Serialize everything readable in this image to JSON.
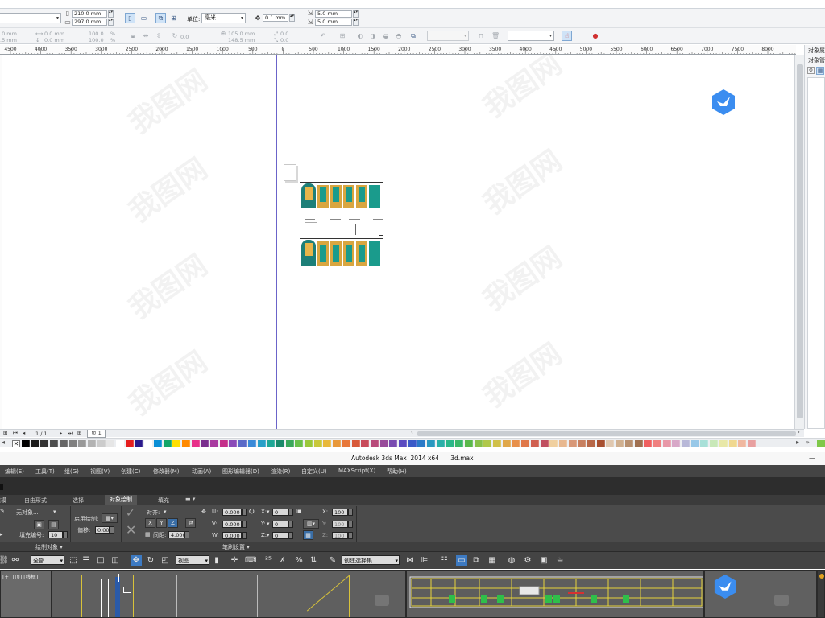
{
  "corel": {
    "propbar": {
      "page_width": "210.0 mm",
      "page_height": "297.0 mm",
      "units_label": "单位:",
      "units_value": "毫米",
      "nudge": "0.1 mm",
      "dup_x": "5.0 mm",
      "dup_y": "5.0 mm"
    },
    "propbar2": {
      "pos_x_a": "0.0 mm",
      "pos_y_a": "0.0 mm",
      "size_w": "0.0 mm",
      "size_h": "0.0 mm",
      "scale_w": "100.0",
      "scale_h": "100.0",
      "pct": "%",
      "rotate": "0.0",
      "rot_x": "105.0 mm",
      "rot_y": "148.5 mm",
      "skew_x": "0.0",
      "skew_y": "0.0",
      "left_x": ".0 mm",
      "left_y": ".5 mm"
    },
    "ruler_ticks": [
      "4500",
      "4000",
      "3500",
      "3000",
      "2500",
      "2000",
      "1500",
      "1000",
      "500",
      "0",
      "500",
      "1000",
      "1500",
      "2000",
      "2500",
      "3000",
      "3500",
      "4000",
      "4500",
      "5000",
      "5500",
      "6000",
      "6500",
      "7000",
      "7500",
      "8000"
    ],
    "docker": {
      "label1": "对象属",
      "label2": "对象管"
    },
    "page_nav": {
      "counter": "1 / 1",
      "page_tab": "页 1"
    },
    "palette_colors": [
      "#000000",
      "#1a1a1a",
      "#333333",
      "#4d4d4d",
      "#666666",
      "#808080",
      "#999999",
      "#b3b3b3",
      "#cccccc",
      "#e6e6e6",
      "#ffffff",
      "#e61e1e",
      "#2a1a8c",
      "#ffffff",
      "#0a8fd6",
      "#12a66a",
      "#ffe000",
      "#ff8a00",
      "#e8308a",
      "#7a2e8e",
      "#a93aa0",
      "#c52f8a",
      "#8a4ab8",
      "#5a6ac8",
      "#3a8ad8",
      "#28a0c8",
      "#1ea896",
      "#1a8a6a",
      "#3aa85a",
      "#6ac04a",
      "#9ac83a",
      "#c8c83a",
      "#e8b83a",
      "#e8983a",
      "#e8783a",
      "#d85a3a",
      "#c84a5a",
      "#b84a7a",
      "#984a9a",
      "#784ab0",
      "#5a4ac0",
      "#3a5ac8",
      "#2a7ac8",
      "#2a98c0",
      "#2ab0a8",
      "#2ab888",
      "#3ab868",
      "#5ab84a",
      "#88c04a",
      "#b0c84a",
      "#d0c04a",
      "#e0a84a",
      "#e8904a",
      "#e0784a",
      "#d06050",
      "#c05060",
      "#f0d0a0",
      "#e8b890",
      "#d89878",
      "#c88060",
      "#b86848",
      "#a85030",
      "#e0c8b0",
      "#d0b090",
      "#b89070",
      "#a07050",
      "#f06060",
      "#f08080",
      "#e898a8",
      "#d8a8c8",
      "#b8b8d8",
      "#98c8e8",
      "#a8e0d8",
      "#c8e8b8",
      "#e8e8a8",
      "#f0d890",
      "#f0b8a0",
      "#e8a0a0"
    ]
  },
  "max": {
    "title": "Autodesk 3ds Max  2014 x64      3d.max",
    "menu": [
      "编辑(E)",
      "工具(T)",
      "组(G)",
      "视图(V)",
      "创建(C)",
      "修改器(M)",
      "动画(A)",
      "图形编辑器(D)",
      "渲染(R)",
      "自定义(U)",
      "MAXScript(X)",
      "帮助(H)"
    ],
    "tabs": [
      "建模",
      "自由形式",
      "选择",
      "对象绘制",
      "填充"
    ],
    "active_tab": "对象绘制",
    "ribbon": {
      "no_object": "无对象...",
      "fill_number_label": "填充编号:",
      "fill_number": "10",
      "paint_on_label": "启用绘制:",
      "offset_label": "偏移:",
      "offset": "0.00",
      "align_label": "对齐:",
      "axes": [
        "X",
        "Y",
        "Z"
      ],
      "spacing_label": "间距:",
      "spacing": "4.000",
      "u_label": "U:",
      "u_val": "0.000",
      "v_label": "V:",
      "v_val": "0.000",
      "w_label": "W:",
      "w_val": "0.000",
      "rx_label": "X:",
      "rx_val": "0",
      "ry_label": "Y:",
      "ry_val": "0",
      "rz_label": "Z:",
      "rz_val": "0",
      "sx_label": "X:",
      "sx_val": "100",
      "sy_label": "Y:",
      "sy_val": "100",
      "sz_label": "Z:",
      "sz_val": "100",
      "panel1": "绘制对象",
      "panel2": "笔刷设置"
    },
    "toolbar": {
      "filter": "全部",
      "view": "视图",
      "selection_set": "创建选择集"
    },
    "viewport_label": "[+] [顶] [线框]"
  },
  "watermark": "我图网"
}
